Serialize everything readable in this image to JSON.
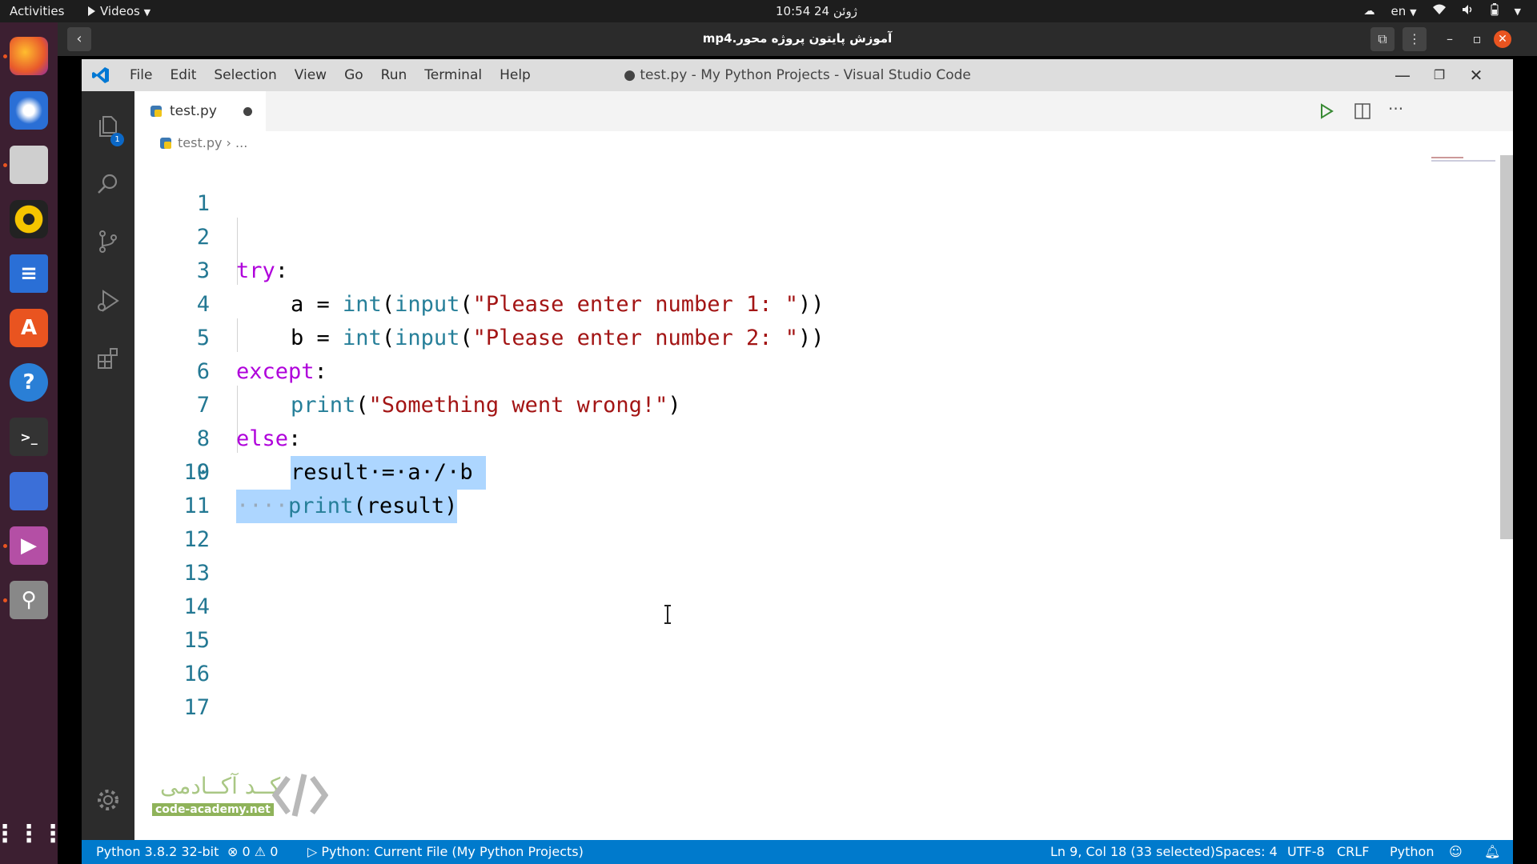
{
  "topbar": {
    "activities": "Activities",
    "app_name": "Videos",
    "clock": "10:54 ژوئن 24",
    "lang": "en"
  },
  "video_player": {
    "title": "آموزش پایتون پروژه محور.mp4"
  },
  "vscode": {
    "menu": [
      "File",
      "Edit",
      "Selection",
      "View",
      "Go",
      "Run",
      "Terminal",
      "Help"
    ],
    "window_title": "● test.py - My Python Projects - Visual Studio Code",
    "tab": {
      "label": "test.py"
    },
    "breadcrumb": {
      "file": "test.py",
      "rest": "..."
    },
    "explorer_badge": "1",
    "editor": {
      "line_numbers": [
        "1",
        "2",
        "3",
        "4",
        "5",
        "6",
        "7",
        "8",
        "9",
        "10",
        "11",
        "12",
        "13",
        "14",
        "15",
        "16",
        "17"
      ],
      "lines": {
        "l2_kw": "try",
        "l2_punct": ":",
        "l3_pre": "a = ",
        "l3_int": "int",
        "l3_p1": "(",
        "l3_input": "input",
        "l3_p2": "(",
        "l3_str": "\"Please enter number 1: \"",
        "l3_end": "))",
        "l4_pre": "b = ",
        "l4_int": "int",
        "l4_p1": "(",
        "l4_input": "input",
        "l4_p2": "(",
        "l4_str": "\"Please enter number 2: \"",
        "l4_end": "))",
        "l5_kw": "except",
        "l5_punct": ":",
        "l6_fn": "print",
        "l6_p1": "(",
        "l6_str": "\"Something went wrong!\"",
        "l6_end": ")",
        "l7_kw": "else",
        "l7_punct": ":",
        "l8_sel": "result·=·a·/·b",
        "l9_ws": "····",
        "l9_fn": "print",
        "l9_rest": "(result)"
      }
    },
    "statusbar": {
      "interpreter": "Python 3.8.2 32-bit",
      "errors": "0",
      "warnings": "0",
      "run_config": "Python: Current File (My Python Projects)",
      "position": "Ln 9, Col 18 (33 selected)",
      "spaces": "Spaces: 4",
      "encoding": "UTF-8",
      "eol": "CRLF",
      "language": "Python"
    }
  },
  "watermark": {
    "brand_fa": "کــد آکــادمی",
    "brand_url": "code-academy.net"
  },
  "colors": {
    "keyword": "#af00db",
    "function": "#267f99",
    "string": "#a31515",
    "line_number": "#237893",
    "selection": "#add6ff",
    "statusbar": "#007acc"
  }
}
